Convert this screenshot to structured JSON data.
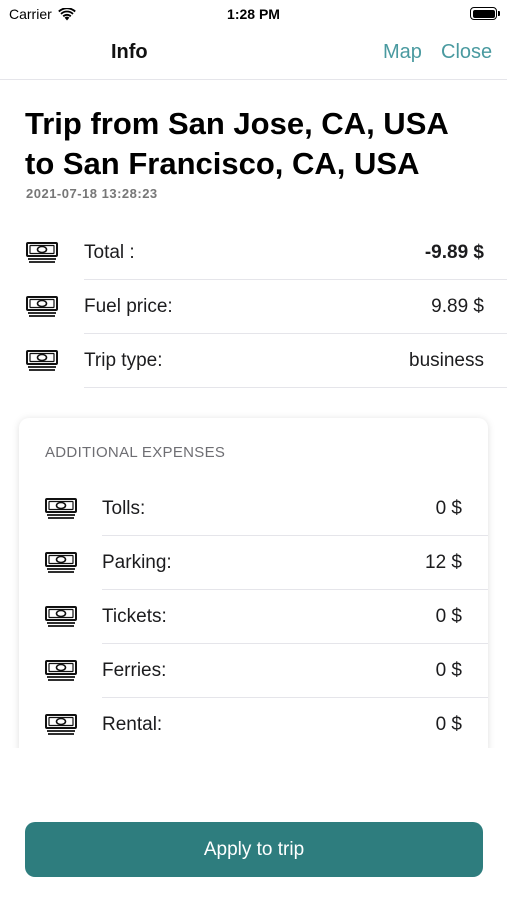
{
  "status_bar": {
    "carrier": "Carrier",
    "time": "1:28 PM"
  },
  "nav": {
    "title": "Info",
    "map_label": "Map",
    "close_label": "Close"
  },
  "trip": {
    "title_line1": "Trip from San Jose, CA, USA",
    "title_line2": "to San Francisco, CA, USA",
    "date": "2021-07-18 13:28:23"
  },
  "summary": [
    {
      "label": "Total :",
      "value": "-9.89 $",
      "icon": "money-icon"
    },
    {
      "label": "Fuel price:",
      "value": "9.89 $",
      "icon": "money-icon"
    },
    {
      "label": "Trip type:",
      "value": "business",
      "icon": "money-icon"
    }
  ],
  "expenses": {
    "header": "ADDITIONAL EXPENSES",
    "items": [
      {
        "label": "Tolls:",
        "value": "0 $",
        "icon": "money-icon"
      },
      {
        "label": "Parking:",
        "value": "12 $",
        "icon": "money-icon"
      },
      {
        "label": "Tickets:",
        "value": "0 $",
        "icon": "money-icon"
      },
      {
        "label": "Ferries:",
        "value": "0 $",
        "icon": "money-icon"
      },
      {
        "label": "Rental:",
        "value": "0 $",
        "icon": "money-icon"
      }
    ]
  },
  "apply_button": {
    "label": "Apply to trip"
  },
  "colors": {
    "accent": "#4a9aa0",
    "button": "#2e7d7e"
  }
}
